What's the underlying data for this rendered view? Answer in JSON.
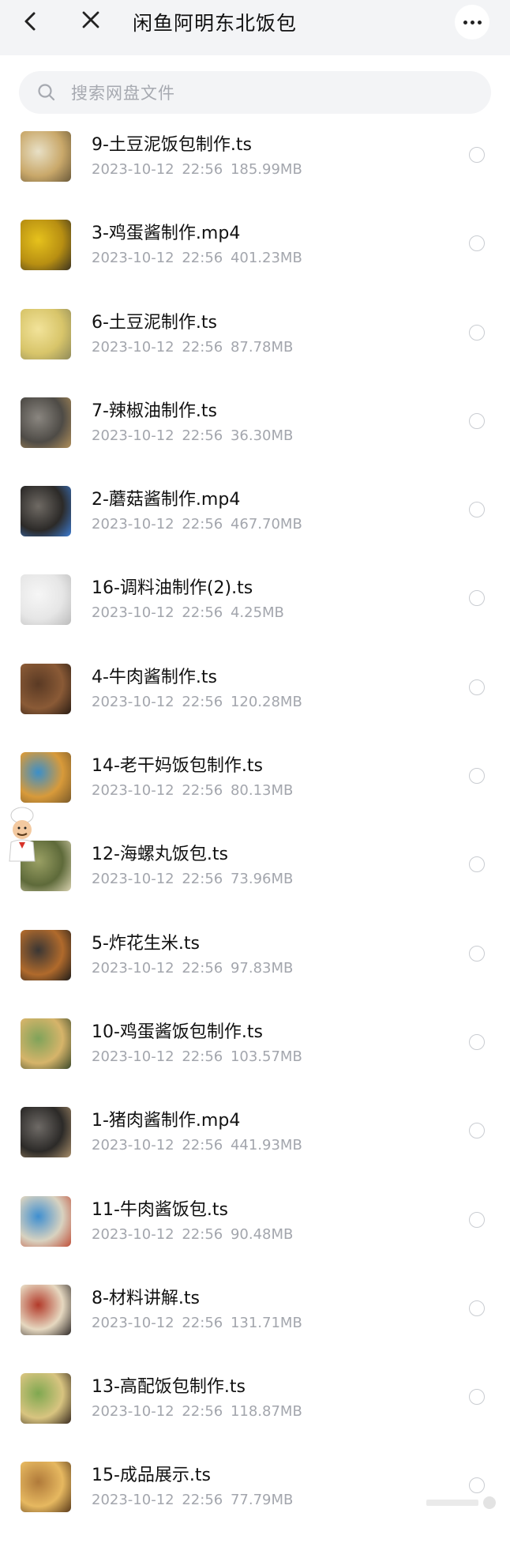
{
  "header": {
    "title": "闲鱼阿明东北饭包"
  },
  "search": {
    "placeholder": "搜索网盘文件"
  },
  "files": [
    {
      "name": "9-土豆泥饭包制作.ts",
      "date": "2023-10-12",
      "time": "22:56",
      "size": "185.99MB",
      "thumb_colors": [
        "#e8e0c6",
        "#c9a86a",
        "#6b5a3a"
      ]
    },
    {
      "name": "3-鸡蛋酱制作.mp4",
      "date": "2023-10-12",
      "time": "22:56",
      "size": "401.23MB",
      "thumb_colors": [
        "#e6c21c",
        "#b88f12",
        "#3b3320"
      ]
    },
    {
      "name": "6-土豆泥制作.ts",
      "date": "2023-10-12",
      "time": "22:56",
      "size": "87.78MB",
      "thumb_colors": [
        "#f2e39a",
        "#d8c56a",
        "#8f8a5a"
      ]
    },
    {
      "name": "7-辣椒油制作.ts",
      "date": "2023-10-12",
      "time": "22:56",
      "size": "36.30MB",
      "thumb_colors": [
        "#8a8680",
        "#4e4b46",
        "#b08f5a"
      ]
    },
    {
      "name": "2-蘑菇酱制作.mp4",
      "date": "2023-10-12",
      "time": "22:56",
      "size": "467.70MB",
      "thumb_colors": [
        "#6f6a64",
        "#2c2a28",
        "#3c7bd1"
      ]
    },
    {
      "name": "16-调料油制作(2).ts",
      "date": "2023-10-12",
      "time": "22:56",
      "size": "4.25MB",
      "thumb_colors": [
        "#f6f6f6",
        "#e6e6e6",
        "#bcbcbc"
      ]
    },
    {
      "name": "4-牛肉酱制作.ts",
      "date": "2023-10-12",
      "time": "22:56",
      "size": "120.28MB",
      "thumb_colors": [
        "#5a3a24",
        "#8a5a36",
        "#2b1d14"
      ]
    },
    {
      "name": "14-老干妈饭包制作.ts",
      "date": "2023-10-12",
      "time": "22:56",
      "size": "80.13MB",
      "thumb_colors": [
        "#3b8fc9",
        "#d89a3a",
        "#7a5a2a"
      ]
    },
    {
      "name": "12-海螺丸饭包.ts",
      "date": "2023-10-12",
      "time": "22:56",
      "size": "73.96MB",
      "thumb_colors": [
        "#9aa064",
        "#5e6a3a",
        "#d9d2b0"
      ]
    },
    {
      "name": "5-炸花生米.ts",
      "date": "2023-10-12",
      "time": "22:56",
      "size": "97.83MB",
      "thumb_colors": [
        "#3a3634",
        "#b06a2c",
        "#1e1c1a"
      ]
    },
    {
      "name": "10-鸡蛋酱饭包制作.ts",
      "date": "2023-10-12",
      "time": "22:56",
      "size": "103.57MB",
      "thumb_colors": [
        "#7fa35a",
        "#d6b46a",
        "#3c4a2a"
      ]
    },
    {
      "name": "1-猪肉酱制作.mp4",
      "date": "2023-10-12",
      "time": "22:56",
      "size": "441.93MB",
      "thumb_colors": [
        "#6e6a66",
        "#2c2a28",
        "#a78d6a"
      ]
    },
    {
      "name": "11-牛肉酱饭包.ts",
      "date": "2023-10-12",
      "time": "22:56",
      "size": "90.48MB",
      "thumb_colors": [
        "#3f8fd0",
        "#d8d2c0",
        "#c0503a"
      ]
    },
    {
      "name": "8-材料讲解.ts",
      "date": "2023-10-12",
      "time": "22:56",
      "size": "131.71MB",
      "thumb_colors": [
        "#b23a2a",
        "#e6d8c0",
        "#2f2a28"
      ]
    },
    {
      "name": "13-高配饭包制作.ts",
      "date": "2023-10-12",
      "time": "22:56",
      "size": "118.87MB",
      "thumb_colors": [
        "#7fa850",
        "#d8c480",
        "#3a2c20"
      ]
    },
    {
      "name": "15-成品展示.ts",
      "date": "2023-10-12",
      "time": "22:56",
      "size": "77.79MB",
      "thumb_colors": [
        "#b07a3a",
        "#e6b860",
        "#5a3a1a"
      ]
    }
  ],
  "colors": {
    "header_bg": "#f3f4f6",
    "meta_text": "#a3a6ad",
    "radio_border": "#c9ccd1"
  }
}
